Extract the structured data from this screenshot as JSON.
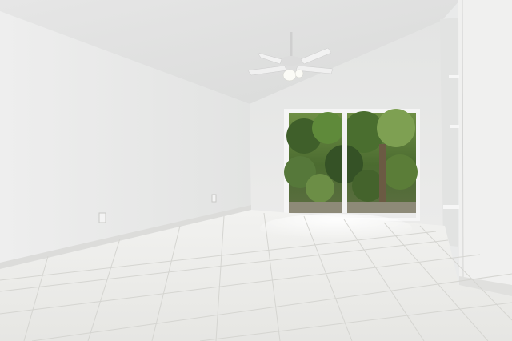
{
  "photo": {
    "subject": "empty-room-with-sliding-glass-door",
    "colors": {
      "ceiling": "#e4e4e4",
      "left_wall": "#ececec",
      "back_wall": "#e6e7e6",
      "floor_tile": "#ededeb",
      "grout": "#d6d6d2",
      "foliage_dark": "#3d5a2a",
      "foliage_light": "#8aa85a",
      "door_frame": "#f4f4f4"
    },
    "icons": [
      "ceiling-fan-icon",
      "power-outlet-icon"
    ]
  }
}
